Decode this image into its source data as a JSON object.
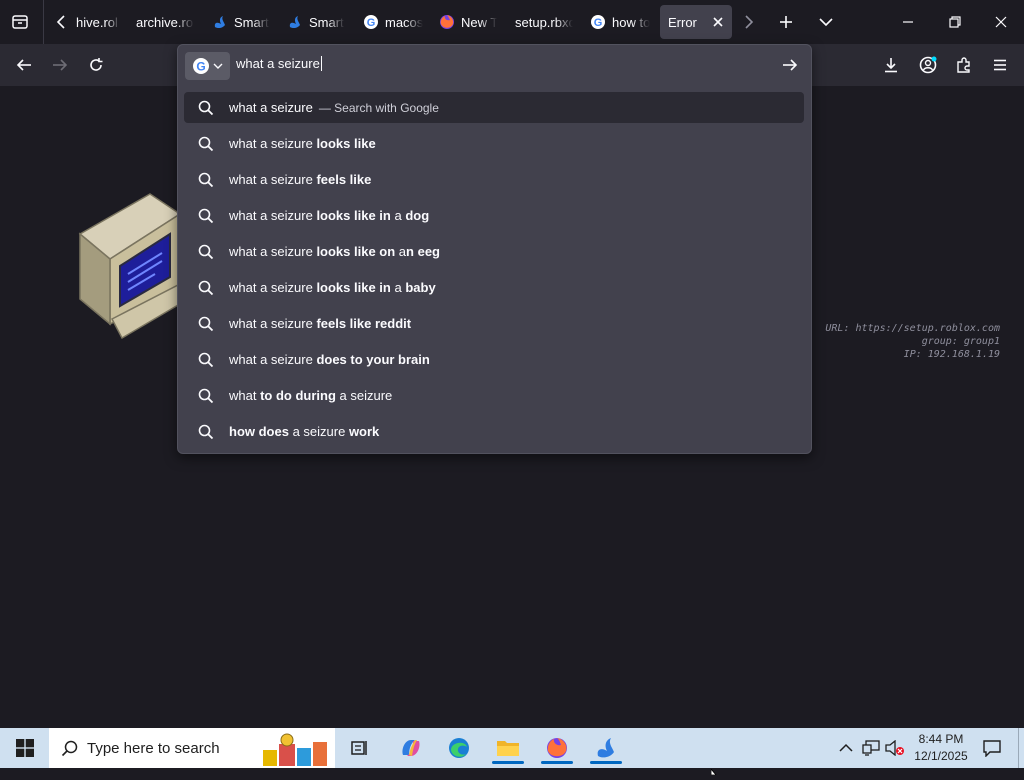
{
  "tabs": [
    {
      "label": "hive.rol",
      "icon": "none-icon"
    },
    {
      "label": "archive.rol",
      "icon": "none-icon"
    },
    {
      "label": "Smart",
      "icon": "smartswan-icon"
    },
    {
      "label": "Smart",
      "icon": "smartswan-icon"
    },
    {
      "label": "macos",
      "icon": "google-icon"
    },
    {
      "label": "New T",
      "icon": "firefox-icon"
    },
    {
      "label": "setup.rbxcd",
      "icon": "none-icon"
    },
    {
      "label": "how to",
      "icon": "google-icon"
    },
    {
      "label": "Error",
      "icon": "none-icon",
      "active": true
    }
  ],
  "urlbar": {
    "value": "what a seizure",
    "engine_icon": "google-icon"
  },
  "suggestions": [
    {
      "plain": "what a seizure",
      "bold": "",
      "after": "",
      "note": "— Search with Google",
      "selected": true
    },
    {
      "plain": "what a seizure ",
      "bold": "looks like",
      "after": "",
      "note": ""
    },
    {
      "plain": "what a seizure ",
      "bold": "feels like",
      "after": "",
      "note": ""
    },
    {
      "plain": "what a seizure ",
      "bold": "looks like in",
      "after": " a ",
      "bold2": "dog",
      "note": ""
    },
    {
      "plain": "what a seizure ",
      "bold": "looks like on",
      "after": " a",
      "bold2": "n eeg",
      "note": ""
    },
    {
      "plain": "what a seizure ",
      "bold": "looks like in",
      "after": " a ",
      "bold2": "baby",
      "note": ""
    },
    {
      "plain": "what a seizure ",
      "bold": "feels like reddit",
      "after": "",
      "note": ""
    },
    {
      "plain": "what a seizure ",
      "bold": "does to your brain",
      "after": "",
      "note": ""
    },
    {
      "plain": "what ",
      "bold": "to do during",
      "after": " a seizure",
      "note": ""
    },
    {
      "plain": "",
      "bold": "how does",
      "after": " a seizure ",
      "bold2": "work",
      "note": ""
    }
  ],
  "error_info": {
    "url_line": "URL: https://setup.roblox.com",
    "group_line": "group: group1",
    "ip_line": "IP: 192.168.1.19"
  },
  "taskbar": {
    "search_placeholder": "Type here to search",
    "time": "8:44 PM",
    "date": "12/1/2025"
  },
  "colors": {
    "accent": "#0067c0",
    "panel": "#42414d",
    "toolbar": "#2b2a33",
    "background": "#1c1b22"
  }
}
